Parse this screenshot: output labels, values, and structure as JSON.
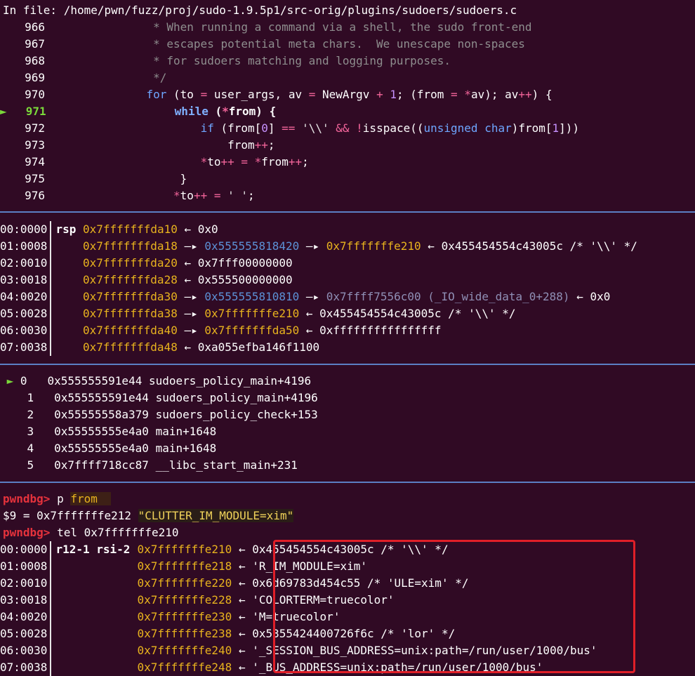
{
  "source": {
    "header": "In file: /home/pwn/fuzz/proj/sudo-1.9.5p1/src-orig/plugins/sudoers/sudoers.c",
    "lines": [
      {
        "num": "966",
        "text": "                * When running a command via a shell, the sudo front-end"
      },
      {
        "num": "967",
        "text": "                * escapes potential meta chars.  We unescape non-spaces"
      },
      {
        "num": "968",
        "text": "                * for sudoers matching and logging purposes."
      },
      {
        "num": "969",
        "text": "                */"
      },
      {
        "num": "970",
        "text": ""
      },
      {
        "num": "971",
        "text": ""
      },
      {
        "num": "972",
        "text": ""
      },
      {
        "num": "973",
        "text": ""
      },
      {
        "num": "974",
        "text": ""
      },
      {
        "num": "975",
        "text": "                    }"
      },
      {
        "num": "976",
        "text": ""
      }
    ],
    "current_marker": "►"
  },
  "stack": {
    "rows": [
      {
        "idx": "00:0000",
        "reg": "rsp",
        "addr": "0x7fffffffda10",
        "rest": "0x0"
      },
      {
        "idx": "01:0008",
        "reg": "",
        "addr": "0x7fffffffda18",
        "p1": "0x555555818420",
        "p2": "0x7fffffffe210",
        "rest": "0x455454554c43005c /* '\\\\' */"
      },
      {
        "idx": "02:0010",
        "reg": "",
        "addr": "0x7fffffffda20",
        "rest": "0x7fff00000000"
      },
      {
        "idx": "03:0018",
        "reg": "",
        "addr": "0x7fffffffda28",
        "rest": "0x555500000000"
      },
      {
        "idx": "04:0020",
        "reg": "",
        "addr": "0x7fffffffda30",
        "p1": "0x555555810810",
        "p2": "0x7ffff7556c00 (_IO_wide_data_0+288)",
        "rest": "0x0"
      },
      {
        "idx": "05:0028",
        "reg": "",
        "addr": "0x7fffffffda38",
        "p1": "0x7fffffffe210",
        "rest": "0x455454554c43005c /* '\\\\' */"
      },
      {
        "idx": "06:0030",
        "reg": "",
        "addr": "0x7fffffffda40",
        "p1": "0x7fffffffda50",
        "rest": "0xffffffffffffffff"
      },
      {
        "idx": "07:0038",
        "reg": "",
        "addr": "0x7fffffffda48",
        "rest": "0xa055efba146f1100"
      }
    ]
  },
  "backtrace": [
    {
      "mark": "►",
      "n": "0",
      "addr": "0x555555591e44",
      "sym": "sudoers_policy_main+4196"
    },
    {
      "mark": "",
      "n": "1",
      "addr": "0x555555591e44",
      "sym": "sudoers_policy_main+4196"
    },
    {
      "mark": "",
      "n": "2",
      "addr": "0x55555558a379",
      "sym": "sudoers_policy_check+153"
    },
    {
      "mark": "",
      "n": "3",
      "addr": "0x55555555e4a0",
      "sym": "main+1648"
    },
    {
      "mark": "",
      "n": "4",
      "addr": "0x55555555e4a0",
      "sym": "main+1648"
    },
    {
      "mark": "",
      "n": "5",
      "addr": "0x7ffff718cc87",
      "sym": "__libc_start_main+231"
    }
  ],
  "console": {
    "prompt": "pwndbg>",
    "cmd1_a": "p",
    "cmd1_b": "from",
    "result_prefix": "$9 = 0x7fffffffe212 ",
    "result_str": "\"CLUTTER_IM_MODULE=xim\"",
    "cmd2": "tel 0x7fffffffe210"
  },
  "tel": {
    "rows": [
      {
        "idx": "00:0000",
        "regs": "r12-1 rsi-2",
        "addr": "0x7fffffffe210",
        "val": "0x455454554c43005c /* '\\\\' */"
      },
      {
        "idx": "01:0008",
        "regs": "",
        "addr": "0x7fffffffe218",
        "val": "'R_IM_MODULE=xim'"
      },
      {
        "idx": "02:0010",
        "regs": "",
        "addr": "0x7fffffffe220",
        "val": "0x6d69783d454c55 /* 'ULE=xim' */"
      },
      {
        "idx": "03:0018",
        "regs": "",
        "addr": "0x7fffffffe228",
        "val": "'COLORTERM=truecolor'"
      },
      {
        "idx": "04:0020",
        "regs": "",
        "addr": "0x7fffffffe230",
        "val": "'M=truecolor'"
      },
      {
        "idx": "05:0028",
        "regs": "",
        "addr": "0x7fffffffe238",
        "val": "0x5355424400726f6c /* 'lor' */"
      },
      {
        "idx": "06:0030",
        "regs": "",
        "addr": "0x7fffffffe240",
        "val": "'_SESSION_BUS_ADDRESS=unix:path=/run/user/1000/bus'"
      },
      {
        "idx": "07:0038",
        "regs": "",
        "addr": "0x7fffffffe248",
        "val": "'_BUS_ADDRESS=unix:path=/run/user/1000/bus'"
      }
    ]
  },
  "glyphs": {
    "left_arrow": "←",
    "right_arrow": "—▸"
  },
  "colors": {
    "background": "#300a24",
    "highlight_box": "#e01f28",
    "separator": "#5b7fc4"
  }
}
